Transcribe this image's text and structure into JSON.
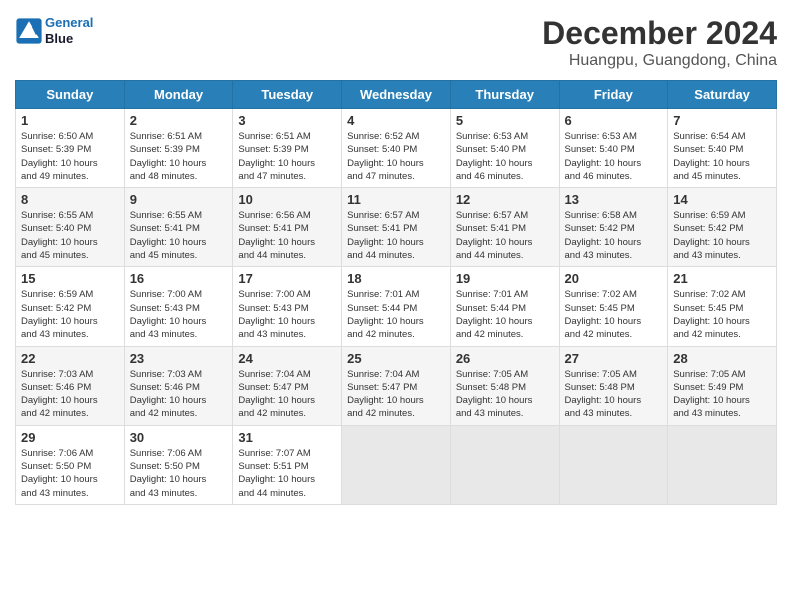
{
  "logo": {
    "line1": "General",
    "line2": "Blue"
  },
  "title": "December 2024",
  "location": "Huangpu, Guangdong, China",
  "days_of_week": [
    "Sunday",
    "Monday",
    "Tuesday",
    "Wednesday",
    "Thursday",
    "Friday",
    "Saturday"
  ],
  "weeks": [
    [
      {
        "day": "1",
        "info": "Sunrise: 6:50 AM\nSunset: 5:39 PM\nDaylight: 10 hours\nand 49 minutes."
      },
      {
        "day": "2",
        "info": "Sunrise: 6:51 AM\nSunset: 5:39 PM\nDaylight: 10 hours\nand 48 minutes."
      },
      {
        "day": "3",
        "info": "Sunrise: 6:51 AM\nSunset: 5:39 PM\nDaylight: 10 hours\nand 47 minutes."
      },
      {
        "day": "4",
        "info": "Sunrise: 6:52 AM\nSunset: 5:40 PM\nDaylight: 10 hours\nand 47 minutes."
      },
      {
        "day": "5",
        "info": "Sunrise: 6:53 AM\nSunset: 5:40 PM\nDaylight: 10 hours\nand 46 minutes."
      },
      {
        "day": "6",
        "info": "Sunrise: 6:53 AM\nSunset: 5:40 PM\nDaylight: 10 hours\nand 46 minutes."
      },
      {
        "day": "7",
        "info": "Sunrise: 6:54 AM\nSunset: 5:40 PM\nDaylight: 10 hours\nand 45 minutes."
      }
    ],
    [
      {
        "day": "8",
        "info": "Sunrise: 6:55 AM\nSunset: 5:40 PM\nDaylight: 10 hours\nand 45 minutes."
      },
      {
        "day": "9",
        "info": "Sunrise: 6:55 AM\nSunset: 5:41 PM\nDaylight: 10 hours\nand 45 minutes."
      },
      {
        "day": "10",
        "info": "Sunrise: 6:56 AM\nSunset: 5:41 PM\nDaylight: 10 hours\nand 44 minutes."
      },
      {
        "day": "11",
        "info": "Sunrise: 6:57 AM\nSunset: 5:41 PM\nDaylight: 10 hours\nand 44 minutes."
      },
      {
        "day": "12",
        "info": "Sunrise: 6:57 AM\nSunset: 5:41 PM\nDaylight: 10 hours\nand 44 minutes."
      },
      {
        "day": "13",
        "info": "Sunrise: 6:58 AM\nSunset: 5:42 PM\nDaylight: 10 hours\nand 43 minutes."
      },
      {
        "day": "14",
        "info": "Sunrise: 6:59 AM\nSunset: 5:42 PM\nDaylight: 10 hours\nand 43 minutes."
      }
    ],
    [
      {
        "day": "15",
        "info": "Sunrise: 6:59 AM\nSunset: 5:42 PM\nDaylight: 10 hours\nand 43 minutes."
      },
      {
        "day": "16",
        "info": "Sunrise: 7:00 AM\nSunset: 5:43 PM\nDaylight: 10 hours\nand 43 minutes."
      },
      {
        "day": "17",
        "info": "Sunrise: 7:00 AM\nSunset: 5:43 PM\nDaylight: 10 hours\nand 43 minutes."
      },
      {
        "day": "18",
        "info": "Sunrise: 7:01 AM\nSunset: 5:44 PM\nDaylight: 10 hours\nand 42 minutes."
      },
      {
        "day": "19",
        "info": "Sunrise: 7:01 AM\nSunset: 5:44 PM\nDaylight: 10 hours\nand 42 minutes."
      },
      {
        "day": "20",
        "info": "Sunrise: 7:02 AM\nSunset: 5:45 PM\nDaylight: 10 hours\nand 42 minutes."
      },
      {
        "day": "21",
        "info": "Sunrise: 7:02 AM\nSunset: 5:45 PM\nDaylight: 10 hours\nand 42 minutes."
      }
    ],
    [
      {
        "day": "22",
        "info": "Sunrise: 7:03 AM\nSunset: 5:46 PM\nDaylight: 10 hours\nand 42 minutes."
      },
      {
        "day": "23",
        "info": "Sunrise: 7:03 AM\nSunset: 5:46 PM\nDaylight: 10 hours\nand 42 minutes."
      },
      {
        "day": "24",
        "info": "Sunrise: 7:04 AM\nSunset: 5:47 PM\nDaylight: 10 hours\nand 42 minutes."
      },
      {
        "day": "25",
        "info": "Sunrise: 7:04 AM\nSunset: 5:47 PM\nDaylight: 10 hours\nand 42 minutes."
      },
      {
        "day": "26",
        "info": "Sunrise: 7:05 AM\nSunset: 5:48 PM\nDaylight: 10 hours\nand 43 minutes."
      },
      {
        "day": "27",
        "info": "Sunrise: 7:05 AM\nSunset: 5:48 PM\nDaylight: 10 hours\nand 43 minutes."
      },
      {
        "day": "28",
        "info": "Sunrise: 7:05 AM\nSunset: 5:49 PM\nDaylight: 10 hours\nand 43 minutes."
      }
    ],
    [
      {
        "day": "29",
        "info": "Sunrise: 7:06 AM\nSunset: 5:50 PM\nDaylight: 10 hours\nand 43 minutes."
      },
      {
        "day": "30",
        "info": "Sunrise: 7:06 AM\nSunset: 5:50 PM\nDaylight: 10 hours\nand 43 minutes."
      },
      {
        "day": "31",
        "info": "Sunrise: 7:07 AM\nSunset: 5:51 PM\nDaylight: 10 hours\nand 44 minutes."
      },
      {
        "day": "",
        "info": ""
      },
      {
        "day": "",
        "info": ""
      },
      {
        "day": "",
        "info": ""
      },
      {
        "day": "",
        "info": ""
      }
    ]
  ]
}
